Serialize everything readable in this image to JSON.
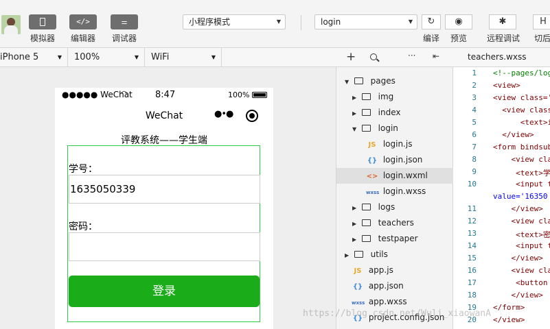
{
  "toolbar": {
    "simulator": {
      "icon": "phone-icon",
      "label": "模拟器"
    },
    "editor": {
      "icon": "code-icon",
      "label": "编辑器"
    },
    "debugger": {
      "icon": "debug-toggle-icon",
      "label": "调试器"
    },
    "mode_select": "小程序模式",
    "page_select": "login",
    "compile_label": "编译",
    "preview_label": "预览",
    "remote_debug_label": "远程调试",
    "cut_label": "切后"
  },
  "subbar": {
    "device": "iPhone 5",
    "zoom": "100%",
    "network": "WiFi"
  },
  "phone": {
    "carrier": "●●●●● WeChat",
    "time": "8:47",
    "battery": "100%",
    "nav_title": "WeChat",
    "page_title": "评教系统——学生端",
    "student_id_label": "学号：",
    "student_id_value": "1635050339",
    "password_label": "密码：",
    "password_value": "",
    "login_button": "登录"
  },
  "tree": {
    "pages": "pages",
    "img": "img",
    "index": "index",
    "login": "login",
    "login_js": "login.js",
    "login_json": "login.json",
    "login_wxml": "login.wxml",
    "login_wxss": "login.wxss",
    "logs": "logs",
    "teachers": "teachers",
    "testpaper": "testpaper",
    "utils": "utils",
    "app_js": "app.js",
    "app_json": "app.json",
    "app_wxss": "app.wxss",
    "project_config": "project.config.json"
  },
  "editor": {
    "tab": "teachers.wxss",
    "line_numbers": [
      "1",
      "2",
      "3",
      "4",
      "5",
      "6",
      "7",
      "8",
      "9",
      "10",
      "11",
      "12",
      "13",
      "14",
      "15",
      "16",
      "17",
      "18",
      "19",
      "20"
    ],
    "lines": [
      "<!--pages/log",
      "<view>",
      "<view class='",
      "  <view class",
      "      <text>i",
      "  </view>",
      "<form bindsub",
      "    <view cla",
      "     <text>学",
      "     <input t",
      "value='16350",
      "    </view>",
      "    <view cla",
      "     <text>密",
      "     <input t",
      "    </view>",
      "    <view cla",
      "     <button ",
      "    </view>",
      "</form>",
      "</view>"
    ]
  },
  "watermark": "https://blog.csdn.net/Wuli_xiaowanA",
  "colors": {
    "accent_green": "#1aad19",
    "form_border": "#2ecc40"
  }
}
